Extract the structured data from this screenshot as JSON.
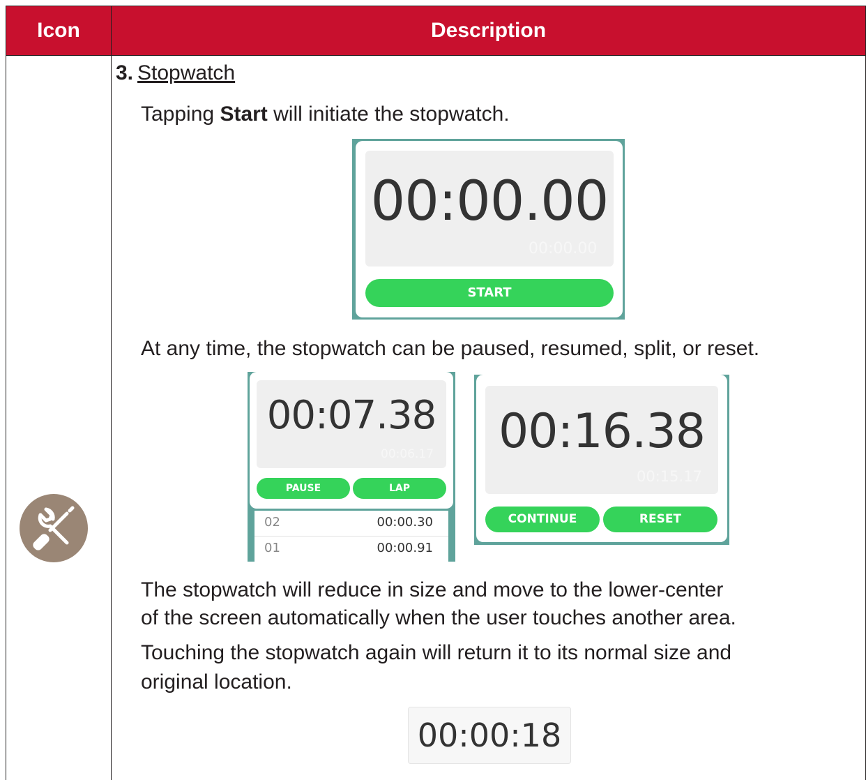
{
  "header": {
    "icon_label": "Icon",
    "description_label": "Description"
  },
  "row_icon": "tools-icon",
  "section": {
    "number": "3.",
    "title": "Stopwatch"
  },
  "intro": {
    "prefix": "Tapping ",
    "bold": "Start",
    "suffix": " will initiate the stopwatch."
  },
  "figure1": {
    "time": "00:00.00",
    "subtime": "00:00.00",
    "button": "START"
  },
  "text2": "At any time, the stopwatch can be paused, resumed, split, or reset.",
  "figure2": {
    "time": "00:07.38",
    "subtime": "00:06.17",
    "buttons": [
      "PAUSE",
      "LAP"
    ],
    "laps": [
      {
        "index": "02",
        "time": "00:00.30"
      },
      {
        "index": "01",
        "time": "00:00.91"
      }
    ]
  },
  "figure3": {
    "time": "00:16.38",
    "subtime": "00:15.17",
    "buttons": [
      "CONTINUE",
      "RESET"
    ]
  },
  "text3": [
    "The stopwatch will reduce in size and move to the lower-center",
    "of the screen automatically when the user touches another area.",
    "Touching the stopwatch again will return it to its normal size and",
    "original location."
  ],
  "mini_timer": "00:00:18",
  "colors": {
    "header_bg": "#c8102e",
    "button_green": "#35d35a",
    "icon_bg": "#9a8675"
  }
}
